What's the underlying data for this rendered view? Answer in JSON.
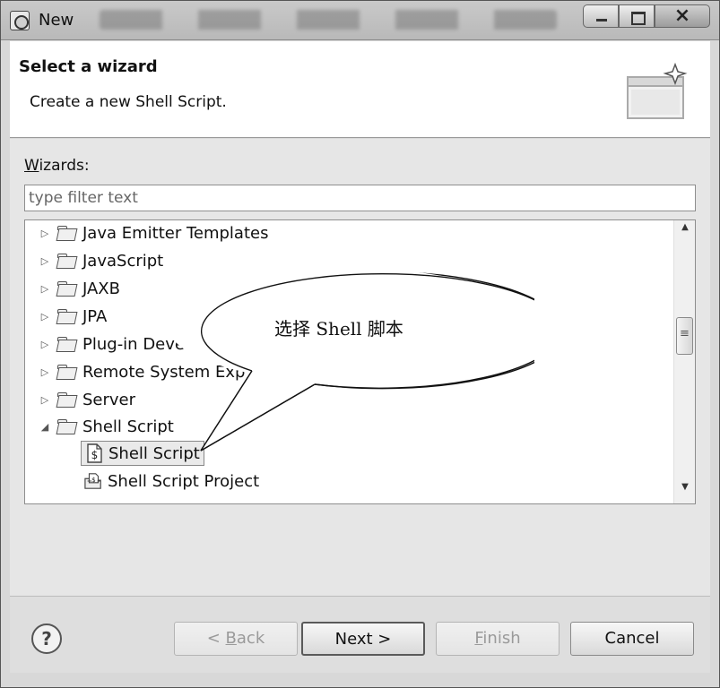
{
  "window": {
    "title": "New"
  },
  "header": {
    "title": "Select a wizard",
    "description": "Create a new Shell Script."
  },
  "wizards": {
    "label_prefix": "W",
    "label_rest": "izards:",
    "filter_placeholder": "type filter text",
    "tree": [
      {
        "label": "Java Emitter Templates",
        "expanded": false,
        "type": "folder"
      },
      {
        "label": "JavaScript",
        "expanded": false,
        "type": "folder"
      },
      {
        "label": "JAXB",
        "expanded": false,
        "type": "folder"
      },
      {
        "label": "JPA",
        "expanded": false,
        "type": "folder"
      },
      {
        "label": "Plug-in Deve",
        "expanded": false,
        "type": "folder"
      },
      {
        "label": "Remote System Exp",
        "expanded": false,
        "type": "folder"
      },
      {
        "label": "Server",
        "expanded": false,
        "type": "folder"
      },
      {
        "label": "Shell Script",
        "expanded": true,
        "type": "folder"
      },
      {
        "label": "Shell Script",
        "type": "item",
        "selected": true,
        "icon": "shell-script-icon"
      },
      {
        "label": "Shell Script Project",
        "type": "item",
        "selected": false,
        "icon": "shell-project-icon"
      }
    ]
  },
  "callout": {
    "text": "选择 Shell 脚本"
  },
  "buttons": {
    "help": "?",
    "back_prefix": "< ",
    "back_mnemonic": "B",
    "back_rest": "ack",
    "next": "Next >",
    "finish_mnemonic": "F",
    "finish_rest": "inish",
    "cancel": "Cancel"
  }
}
